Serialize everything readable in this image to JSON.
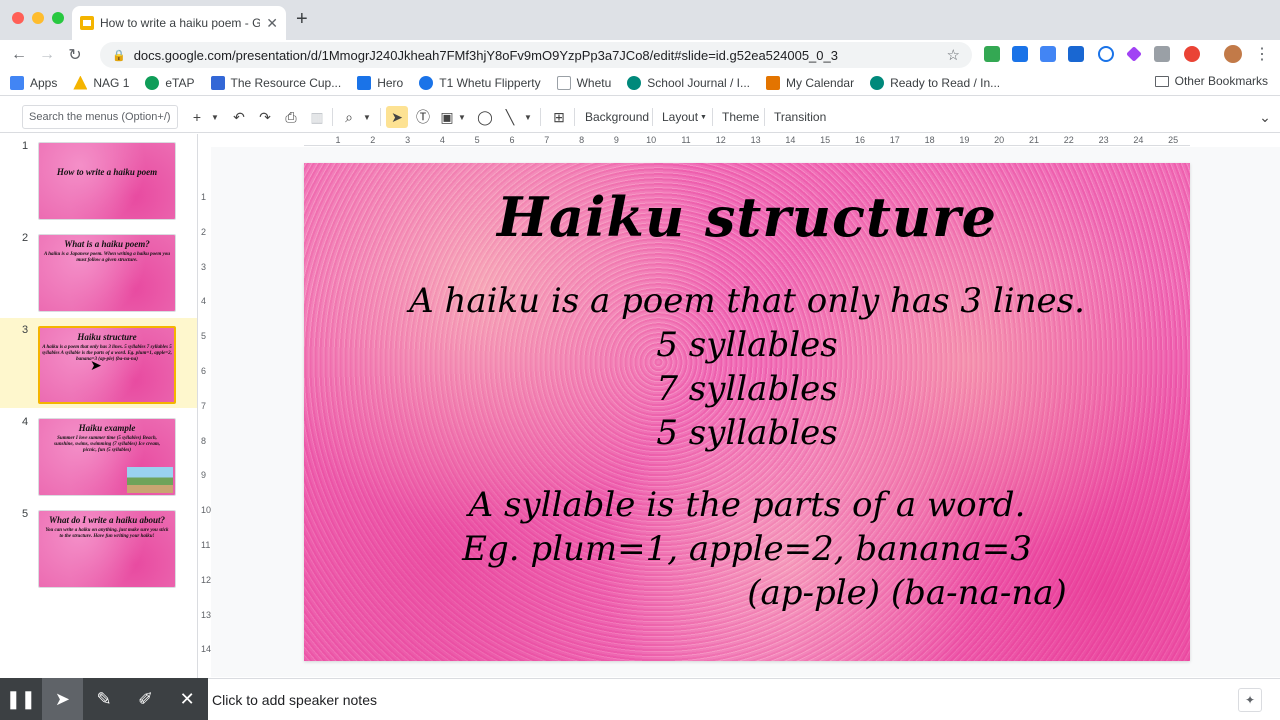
{
  "browser": {
    "tab_title": "How to write a haiku poem - Go",
    "url": "docs.google.com/presentation/d/1MmogrJ240Jkheah7FMf3hjY8oFv9mO9YzpPp3a7JCo8/edit#slide=id.g52ea524005_0_3"
  },
  "bookmarks": [
    {
      "label": "Apps",
      "color": "#4285f4"
    },
    {
      "label": "NAG 1",
      "color": "#f4b400"
    },
    {
      "label": "eTAP",
      "color": "#0f9d58"
    },
    {
      "label": "The Resource Cup...",
      "color": "#3367d6"
    },
    {
      "label": "Hero",
      "color": "#1a73e8"
    },
    {
      "label": "T1 Whetu Flipperty",
      "color": "#1a73e8"
    },
    {
      "label": "Whetu",
      "color": "#5f6368"
    },
    {
      "label": "School Journal / I...",
      "color": "#00897b"
    },
    {
      "label": "My Calendar",
      "color": "#e37400"
    },
    {
      "label": "Ready to Read / In...",
      "color": "#00897b"
    }
  ],
  "other_bookmarks": "Other Bookmarks",
  "toolbar": {
    "search_placeholder": "Search the menus (Option+/)",
    "background": "Background",
    "layout": "Layout",
    "theme": "Theme",
    "transition": "Transition"
  },
  "ruler": {
    "h": [
      "1",
      "2",
      "3",
      "4",
      "5",
      "6",
      "7",
      "8",
      "9",
      "10",
      "11",
      "12",
      "13",
      "14",
      "15",
      "16",
      "17",
      "18",
      "19",
      "20",
      "21",
      "22",
      "23",
      "24",
      "25"
    ],
    "v": [
      "1",
      "2",
      "3",
      "4",
      "5",
      "6",
      "7",
      "8",
      "9",
      "10",
      "11",
      "12",
      "13",
      "14"
    ]
  },
  "thumbnails": [
    {
      "num": "1",
      "title": "How to write a haiku poem",
      "body": ""
    },
    {
      "num": "2",
      "title": "What is a haiku poem?",
      "body": "A haiku is a Japanese poem. When writing a haiku poem you must follow a given structure."
    },
    {
      "num": "3",
      "title": "Haiku structure",
      "body": "A haiku is a poem that only has 3 lines. 5 syllables 7 syllables 5 syllables A syllable is the parts of a word. Eg. plum=1, apple=2, banana=3 (ap-ple) (ba-na-na)"
    },
    {
      "num": "4",
      "title": "Haiku example",
      "body": "Summer I love summer time (5 syllables) Beach, sunshine, swims, swimming (7 syllables) Ice cream, picnic, fun (5 syllables)"
    },
    {
      "num": "5",
      "title": "What do I write a haiku about?",
      "body": "You can write a haiku on anything, just make sure you stick to the structure. Have fun writing your haiku!"
    }
  ],
  "slide": {
    "title": "Haiku structure",
    "line1": "A haiku is a poem that only has 3 lines.",
    "line2": "5 syllables",
    "line3": "7 syllables",
    "line4": "5 syllables",
    "line5": "A syllable is the parts of a word.",
    "line6": "Eg. plum=1, apple=2, banana=3",
    "line7": "(ap-ple) (ba-na-na)"
  },
  "notes_placeholder": "Click to add speaker notes",
  "colors": {
    "accent": "#f4b400",
    "slide_pink": "#ee6fb4",
    "presenter_bar": "#3c4043"
  }
}
